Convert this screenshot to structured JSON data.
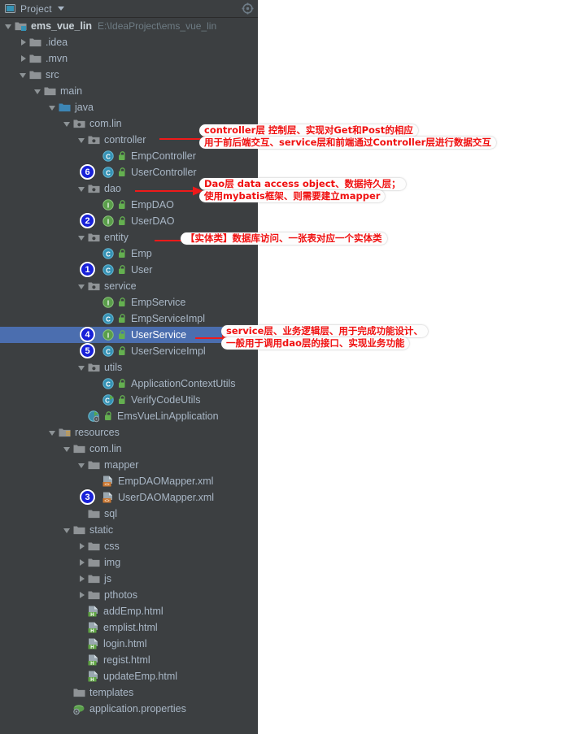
{
  "header": {
    "title": "Project",
    "icon": "project-window-icon",
    "dropdown_icon": "chevron-down-icon",
    "right_icon": "locate-target-icon"
  },
  "colors": {
    "panel_bg": "#3c3f41",
    "selection": "#4b6eaf",
    "text": "#a9b7c6",
    "annotation_red": "#f01010",
    "badge_blue": "#1821d8",
    "class_icon": "#3592b5",
    "interface_icon": "#5a9e4b",
    "folder": "#8f9396",
    "source_root": "#3d86b5"
  },
  "tree": [
    {
      "depth": 0,
      "arrow": "down",
      "icon": "module-icon",
      "label": "ems_vue_lin",
      "bold": true,
      "sublabel": "E:\\IdeaProject\\ems_vue_lin"
    },
    {
      "depth": 1,
      "arrow": "right",
      "icon": "folder-icon",
      "label": ".idea"
    },
    {
      "depth": 1,
      "arrow": "right",
      "icon": "folder-icon",
      "label": ".mvn"
    },
    {
      "depth": 1,
      "arrow": "down",
      "icon": "folder-icon",
      "label": "src"
    },
    {
      "depth": 2,
      "arrow": "down",
      "icon": "folder-icon",
      "label": "main"
    },
    {
      "depth": 3,
      "arrow": "down",
      "icon": "source-root-icon",
      "label": "java"
    },
    {
      "depth": 4,
      "arrow": "down",
      "icon": "package-icon",
      "label": "com.lin"
    },
    {
      "depth": 5,
      "arrow": "down",
      "icon": "package-icon",
      "label": "controller"
    },
    {
      "depth": 6,
      "arrow": "none",
      "icon": "class-icon",
      "label": "EmpController",
      "lock": true
    },
    {
      "depth": 6,
      "arrow": "none",
      "icon": "class-icon",
      "label": "UserController",
      "lock": true,
      "marker": "6"
    },
    {
      "depth": 5,
      "arrow": "down",
      "icon": "package-icon",
      "label": "dao"
    },
    {
      "depth": 6,
      "arrow": "none",
      "icon": "interface-icon",
      "label": "EmpDAO",
      "lock": true
    },
    {
      "depth": 6,
      "arrow": "none",
      "icon": "interface-icon",
      "label": "UserDAO",
      "lock": true,
      "marker": "2"
    },
    {
      "depth": 5,
      "arrow": "down",
      "icon": "package-icon",
      "label": "entity"
    },
    {
      "depth": 6,
      "arrow": "none",
      "icon": "class-icon",
      "label": "Emp",
      "lock": true
    },
    {
      "depth": 6,
      "arrow": "none",
      "icon": "class-icon",
      "label": "User",
      "lock": true,
      "marker": "1"
    },
    {
      "depth": 5,
      "arrow": "down",
      "icon": "package-icon",
      "label": "service"
    },
    {
      "depth": 6,
      "arrow": "none",
      "icon": "interface-icon",
      "label": "EmpService",
      "lock": true
    },
    {
      "depth": 6,
      "arrow": "none",
      "icon": "class-icon",
      "label": "EmpServiceImpl",
      "lock": true
    },
    {
      "depth": 6,
      "arrow": "none",
      "icon": "interface-icon",
      "label": "UserService",
      "lock": true,
      "marker": "4",
      "selected": true
    },
    {
      "depth": 6,
      "arrow": "none",
      "icon": "class-icon",
      "label": "UserServiceImpl",
      "lock": true,
      "marker": "5"
    },
    {
      "depth": 5,
      "arrow": "down",
      "icon": "package-icon",
      "label": "utils"
    },
    {
      "depth": 6,
      "arrow": "none",
      "icon": "class-icon",
      "label": "ApplicationContextUtils",
      "lock": true
    },
    {
      "depth": 6,
      "arrow": "none",
      "icon": "class-run-icon",
      "label": "VerifyCodeUtils",
      "lock": true
    },
    {
      "depth": 5,
      "arrow": "none",
      "icon": "spring-app-icon",
      "label": "EmsVueLinApplication",
      "lock": true
    },
    {
      "depth": 3,
      "arrow": "down",
      "icon": "resource-root-icon",
      "label": "resources"
    },
    {
      "depth": 4,
      "arrow": "down",
      "icon": "folder-icon",
      "label": "com.lin"
    },
    {
      "depth": 5,
      "arrow": "down",
      "icon": "folder-icon",
      "label": "mapper"
    },
    {
      "depth": 6,
      "arrow": "none",
      "icon": "xml-file-icon",
      "label": "EmpDAOMapper.xml"
    },
    {
      "depth": 6,
      "arrow": "none",
      "icon": "xml-file-icon",
      "label": "UserDAOMapper.xml",
      "marker": "3"
    },
    {
      "depth": 5,
      "arrow": "none",
      "icon": "folder-icon",
      "label": "sql"
    },
    {
      "depth": 4,
      "arrow": "down",
      "icon": "folder-icon",
      "label": "static"
    },
    {
      "depth": 5,
      "arrow": "right",
      "icon": "folder-icon",
      "label": "css"
    },
    {
      "depth": 5,
      "arrow": "right",
      "icon": "folder-icon",
      "label": "img"
    },
    {
      "depth": 5,
      "arrow": "right",
      "icon": "folder-icon",
      "label": "js"
    },
    {
      "depth": 5,
      "arrow": "right",
      "icon": "folder-icon",
      "label": "pthotos"
    },
    {
      "depth": 5,
      "arrow": "none",
      "icon": "html-file-icon",
      "label": "addEmp.html"
    },
    {
      "depth": 5,
      "arrow": "none",
      "icon": "html-file-icon",
      "label": "emplist.html"
    },
    {
      "depth": 5,
      "arrow": "none",
      "icon": "html-file-icon",
      "label": "login.html"
    },
    {
      "depth": 5,
      "arrow": "none",
      "icon": "html-file-icon",
      "label": "regist.html"
    },
    {
      "depth": 5,
      "arrow": "none",
      "icon": "html-file-icon",
      "label": "updateEmp.html"
    },
    {
      "depth": 4,
      "arrow": "none",
      "icon": "folder-icon",
      "label": "templates"
    },
    {
      "depth": 4,
      "arrow": "none",
      "icon": "properties-file-icon",
      "label": "application.properties"
    }
  ],
  "annotations": [
    {
      "id": "controller-note",
      "lines": [
        "controller层 控制层、实现对Get和Post的相应",
        "用于前后端交互、service层和前端通过Controller层进行数据交互"
      ]
    },
    {
      "id": "dao-note",
      "lines": [
        "Dao层 data access object、数据持久层；",
        "使用mybatis框架、则需要建立mapper"
      ]
    },
    {
      "id": "entity-note",
      "lines": [
        "【实体类】数据库访问、一张表对应一个实体类"
      ]
    },
    {
      "id": "service-note",
      "lines": [
        "service层、业务逻辑层、用于完成功能设计、",
        "一般用于调用dao层的接口、实现业务功能"
      ]
    }
  ]
}
